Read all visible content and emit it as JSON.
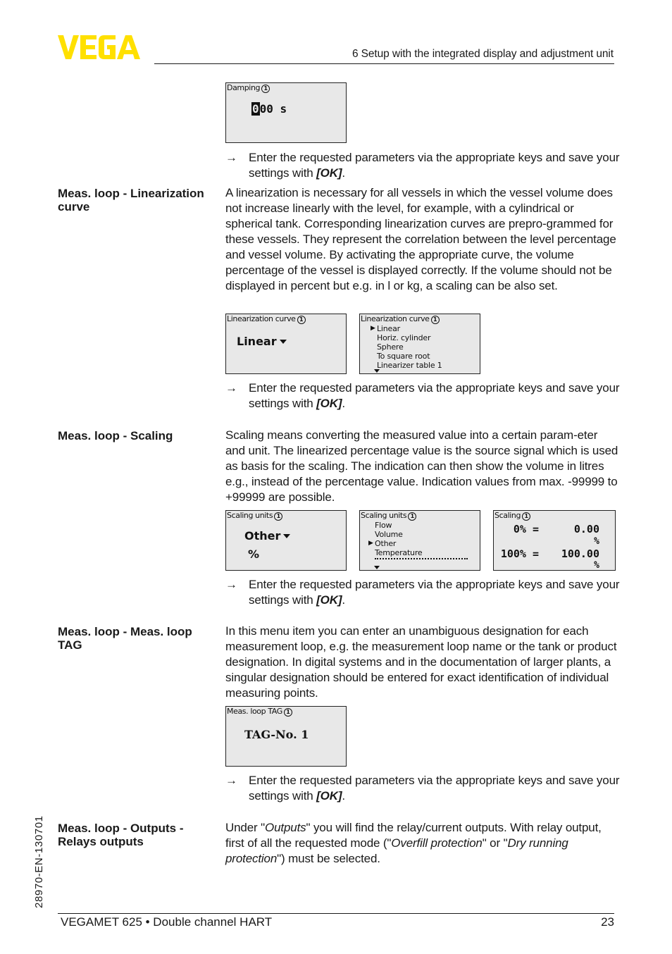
{
  "header": {
    "logo_text": "VEGA",
    "brand_color": "#ffe000",
    "chapter_title": "6 Setup with the integrated display and adjustment unit"
  },
  "step_instruction": {
    "arrow": "→",
    "text": "Enter the requested parameters via the appropriate keys and save your settings with ",
    "key": "[OK]",
    "end": "."
  },
  "damping_display": {
    "title": "Damping",
    "info_icon": "1",
    "cursor_digit": "0",
    "value_rest": "00 s"
  },
  "sections": [
    {
      "label": "Meas. loop - Linearization curve",
      "text": "A linearization is necessary for all vessels in which the vessel volume does not increase linearly with the level, for example, with a cylindrical or spherical tank. Corresponding linearization curves are prepro-grammed for these vessels. They represent the correlation between the level percentage and vessel volume. By activating the appropriate curve, the volume percentage of the vessel is displayed correctly. If the volume should not be displayed in percent but e.g. in l or kg, a scaling can be also set."
    },
    {
      "label": "Meas. loop - Scaling",
      "text": "Scaling means converting the measured value into a certain param-eter and unit. The linearized percentage value is the source signal which is used as basis for the scaling. The indication can then show the volume in litres e.g., instead of the percentage value. Indication values from max. -99999 to +99999 are possible."
    },
    {
      "label": "Meas. loop - Meas. loop TAG",
      "text": "In this menu item you can enter an unambiguous designation for each measurement loop, e.g. the measurement loop name or the tank or product designation. In digital systems and in the documentation of larger plants, a singular designation should be entered for exact identification of individual measuring points."
    },
    {
      "label": "Meas. loop - Outputs - Relays outputs",
      "text_parts": [
        "Under \"",
        "Outputs",
        "\" you will find the relay/current outputs. With relay output, first of all the requested mode (\"",
        "Overfill protection",
        "\" or \"",
        "Dry running protection",
        "\") must be selected."
      ]
    }
  ],
  "linearization_displays": {
    "selected": {
      "title": "Linearization curve",
      "value": "Linear"
    },
    "list": {
      "title": "Linearization curve",
      "options": [
        "Linear",
        "Horiz. cylinder",
        "Sphere",
        "To square root",
        "Linearizer table 1"
      ],
      "selected_index": 0
    }
  },
  "scaling_displays": {
    "units_selected": {
      "title": "Scaling units",
      "value": "Other",
      "unit": "%"
    },
    "units_list": {
      "title": "Scaling units",
      "options": [
        "Flow",
        "Volume",
        "Other",
        "Temperature"
      ],
      "selected_index": 2
    },
    "scaling": {
      "title": "Scaling",
      "row1_label": "0% =",
      "row1_value": "0.00",
      "row1_unit": "%",
      "row2_label": "100% =",
      "row2_value": "100.00",
      "row2_unit": "%"
    }
  },
  "tag_display": {
    "title": "Meas. loop TAG",
    "value": "TAG-No. 1"
  },
  "footer": {
    "product": "VEGAMET 625 • Double channel HART",
    "page_number": "23",
    "doc_code": "28970-EN-130701"
  }
}
